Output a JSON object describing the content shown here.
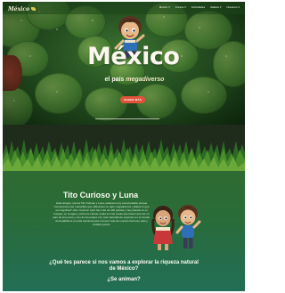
{
  "header": {
    "logo_text": "México",
    "nav": [
      {
        "label": "Mexico",
        "has_menu": true
      },
      {
        "label": "Cursos",
        "has_menu": true
      },
      {
        "label": "Actividades",
        "has_menu": false
      },
      {
        "label": "Aliados",
        "has_menu": true
      },
      {
        "label": "Nosotros",
        "has_menu": true
      }
    ]
  },
  "hero": {
    "title": "México",
    "subtitle_lead": "el país ",
    "subtitle_em": "megadiverso",
    "button_label": "SABER MÁS"
  },
  "story": {
    "title": "Tito Curioso y Luna",
    "body": "Hola amigos, somos Tito Curioso y Luna, estamos muy emocionados porque conoceremos las maravillas que ¡Méxicoes un país megadiverso! ¿Sabes lo que eso significa? ¡Son muchos! Aquí hay más de 200 plantas y hay plantas en el bosque, en el agua y entre los cactus, estas son las cosas que hacen que ser un país de los pocos y uno de los países con más variedad de especies en el mundo. Acompáñanos en esta aventura para conocer más de nuestro hermoso país y cuidarlo juntos.",
    "question": "¿Qué tes parece si nos vamos a explorar la riqueza natural de México?",
    "cta": "¿Se animan?"
  },
  "colors": {
    "accent_button": "#e1523a",
    "hero_green": "#2c5d27",
    "story_green": "#2a6c39"
  }
}
